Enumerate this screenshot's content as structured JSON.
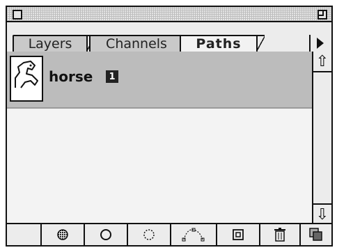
{
  "palette": {
    "tabs": [
      {
        "label": "Layers",
        "active": false
      },
      {
        "label": "Channels",
        "active": false
      },
      {
        "label": "Paths",
        "active": true
      }
    ]
  },
  "paths": [
    {
      "name": "horse",
      "badge": "1",
      "thumbnail_icon": "horse-path-thumbnail",
      "selected": true
    }
  ],
  "scrollbar": {
    "up_icon": "scroll-up-arrow",
    "down_icon": "scroll-down-arrow"
  },
  "toolbar": {
    "buttons": [
      {
        "icon": "fill-path-icon"
      },
      {
        "icon": "stroke-path-icon"
      },
      {
        "icon": "load-path-as-selection-icon"
      },
      {
        "icon": "make-work-path-icon"
      },
      {
        "icon": "new-path-icon"
      },
      {
        "icon": "delete-path-icon"
      },
      {
        "icon": "resize-box-icon"
      }
    ]
  }
}
